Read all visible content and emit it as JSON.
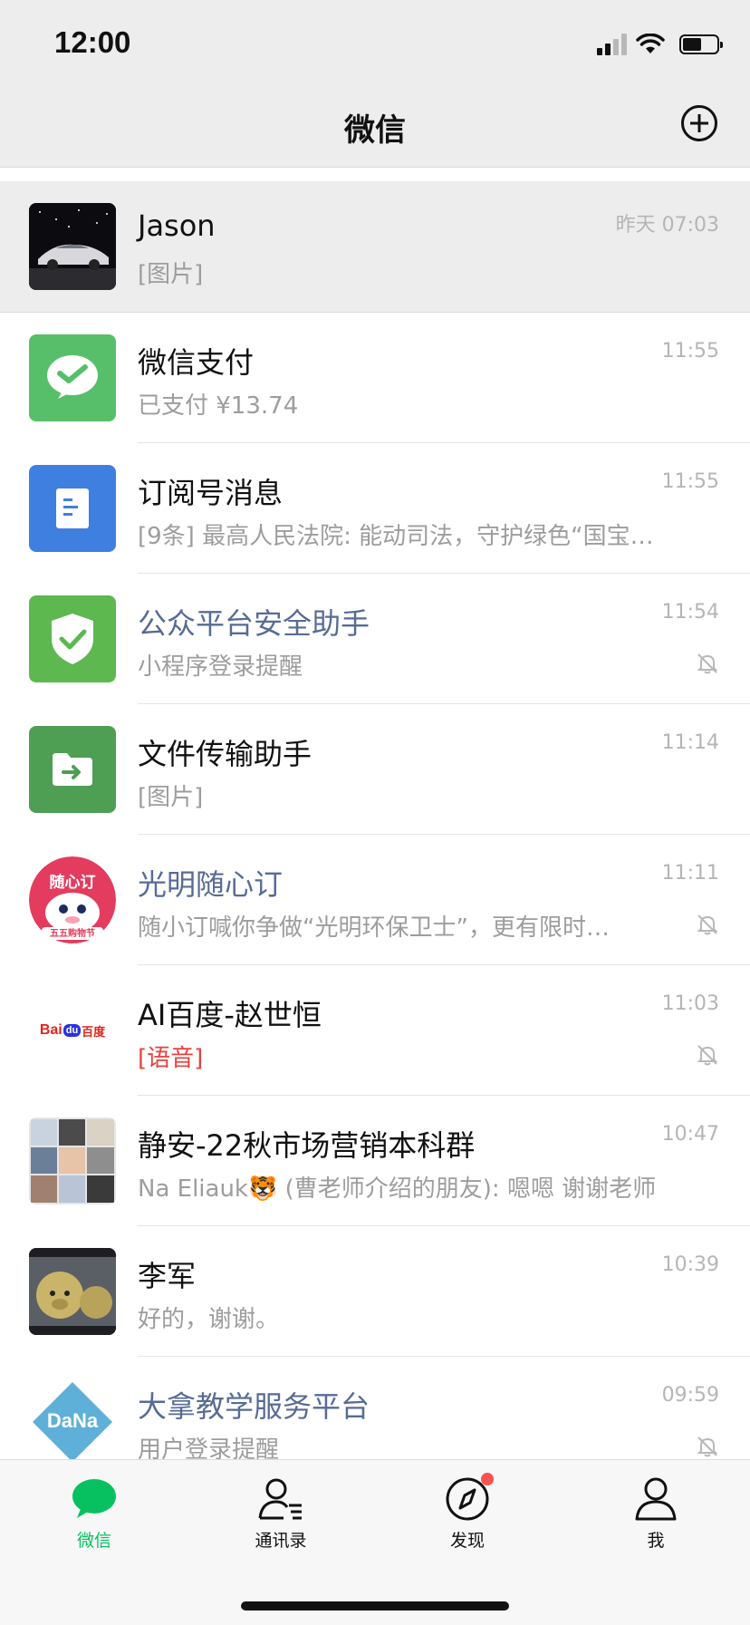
{
  "status_bar": {
    "time": "12:00"
  },
  "nav": {
    "title": "微信",
    "add_icon": "plus-circle-icon"
  },
  "chats": [
    {
      "name": "Jason",
      "preview": "[图片]",
      "time": "昨天 07:03",
      "pinned": true,
      "muted": false,
      "official": false,
      "avatar": "car-photo"
    },
    {
      "name": "微信支付",
      "preview": "已支付 ¥13.74",
      "time": "11:55",
      "muted": false,
      "official": false,
      "avatar": "wechat-pay-icon"
    },
    {
      "name": "订阅号消息",
      "preview": "[9条] 最高人民法院: 能动司法，守护绿色“国宝”…",
      "time": "11:55",
      "muted": false,
      "official": false,
      "avatar": "subscription-icon"
    },
    {
      "name": "公众平台安全助手",
      "preview": "小程序登录提醒",
      "time": "11:54",
      "muted": true,
      "official": true,
      "avatar": "shield-icon"
    },
    {
      "name": "文件传输助手",
      "preview": "[图片]",
      "time": "11:14",
      "muted": false,
      "official": false,
      "avatar": "file-transfer-icon"
    },
    {
      "name": "光明随心订",
      "preview": "随小订喊你争做“光明环保卫士”，更有限时…",
      "time": "11:11",
      "muted": true,
      "official": true,
      "avatar": "guangming-logo",
      "avatar_text": "随心订",
      "avatar_subtext": "五五购物节"
    },
    {
      "name": "AI百度-赵世恒",
      "preview": "[语音]",
      "time": "11:03",
      "muted": true,
      "official": false,
      "preview_red": true,
      "avatar": "baidu-logo",
      "avatar_text_left": "Bai",
      "avatar_text_mid": "du",
      "avatar_text_right": "百度"
    },
    {
      "name": "静安-22秋市场营销本科群",
      "preview": "Na Eliauk🐯 (曹老师介绍的朋友): 嗯嗯 谢谢老师",
      "time": "10:47",
      "muted": false,
      "official": false,
      "avatar": "group-grid"
    },
    {
      "name": "李军",
      "preview": "好的，谢谢。",
      "time": "10:39",
      "muted": false,
      "official": false,
      "avatar": "pig-photo"
    },
    {
      "name": "大拿教学服务平台",
      "preview": "用户登录提醒",
      "time": "09:59",
      "muted": true,
      "official": true,
      "avatar": "dana-logo",
      "avatar_text": "DaNa"
    }
  ],
  "tabs": [
    {
      "label": "微信",
      "icon": "chat-bubble-icon",
      "active": true
    },
    {
      "label": "通讯录",
      "icon": "contacts-icon",
      "active": false
    },
    {
      "label": "发现",
      "icon": "compass-icon",
      "active": false,
      "badge": true
    },
    {
      "label": "我",
      "icon": "person-icon",
      "active": false
    }
  ],
  "colors": {
    "accent": "#07c160",
    "official_name": "#576b95",
    "badge": "#fa5151"
  }
}
